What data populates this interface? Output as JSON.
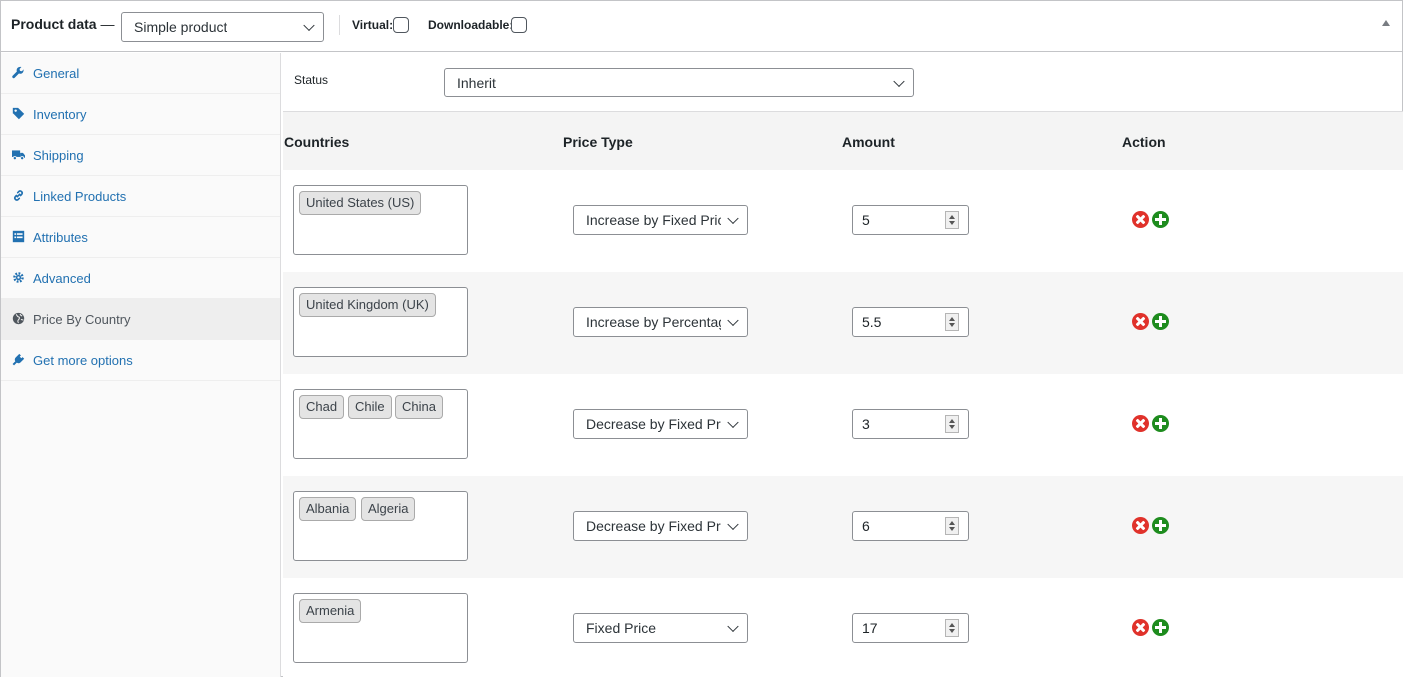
{
  "header": {
    "title": "Product data",
    "dash": "—",
    "product_type": "Simple product",
    "virtual_label": "Virtual:",
    "downloadable_label": "Downloadable:"
  },
  "sidebar": {
    "items": [
      {
        "label": "General",
        "icon": "wrench-icon"
      },
      {
        "label": "Inventory",
        "icon": "tag-icon"
      },
      {
        "label": "Shipping",
        "icon": "truck-icon"
      },
      {
        "label": "Linked Products",
        "icon": "link-icon"
      },
      {
        "label": "Attributes",
        "icon": "list-icon"
      },
      {
        "label": "Advanced",
        "icon": "gear-icon"
      },
      {
        "label": "Price By Country",
        "icon": "globe-icon",
        "active": true
      },
      {
        "label": "Get more options",
        "icon": "plugin-icon"
      }
    ]
  },
  "status": {
    "label": "Status",
    "value": "Inherit"
  },
  "table": {
    "headers": {
      "countries": "Countries",
      "price_type": "Price Type",
      "amount": "Amount",
      "action": "Action"
    },
    "rows": [
      {
        "countries": [
          "United States (US)"
        ],
        "price_type": "Increase by Fixed Price",
        "amount": "5"
      },
      {
        "countries": [
          "United Kingdom (UK)"
        ],
        "price_type": "Increase by Percentage",
        "amount": "5.5"
      },
      {
        "countries": [
          "Chad",
          "Chile",
          "China"
        ],
        "price_type": "Decrease by Fixed Price",
        "amount": "3"
      },
      {
        "countries": [
          "Albania",
          "Algeria"
        ],
        "price_type": "Decrease by Fixed Price",
        "amount": "6"
      },
      {
        "countries": [
          "Armenia"
        ],
        "price_type": "Fixed Price",
        "amount": "17"
      }
    ]
  },
  "colors": {
    "link": "#2271b1",
    "remove": "#e0322b",
    "add": "#1e8c1e"
  }
}
